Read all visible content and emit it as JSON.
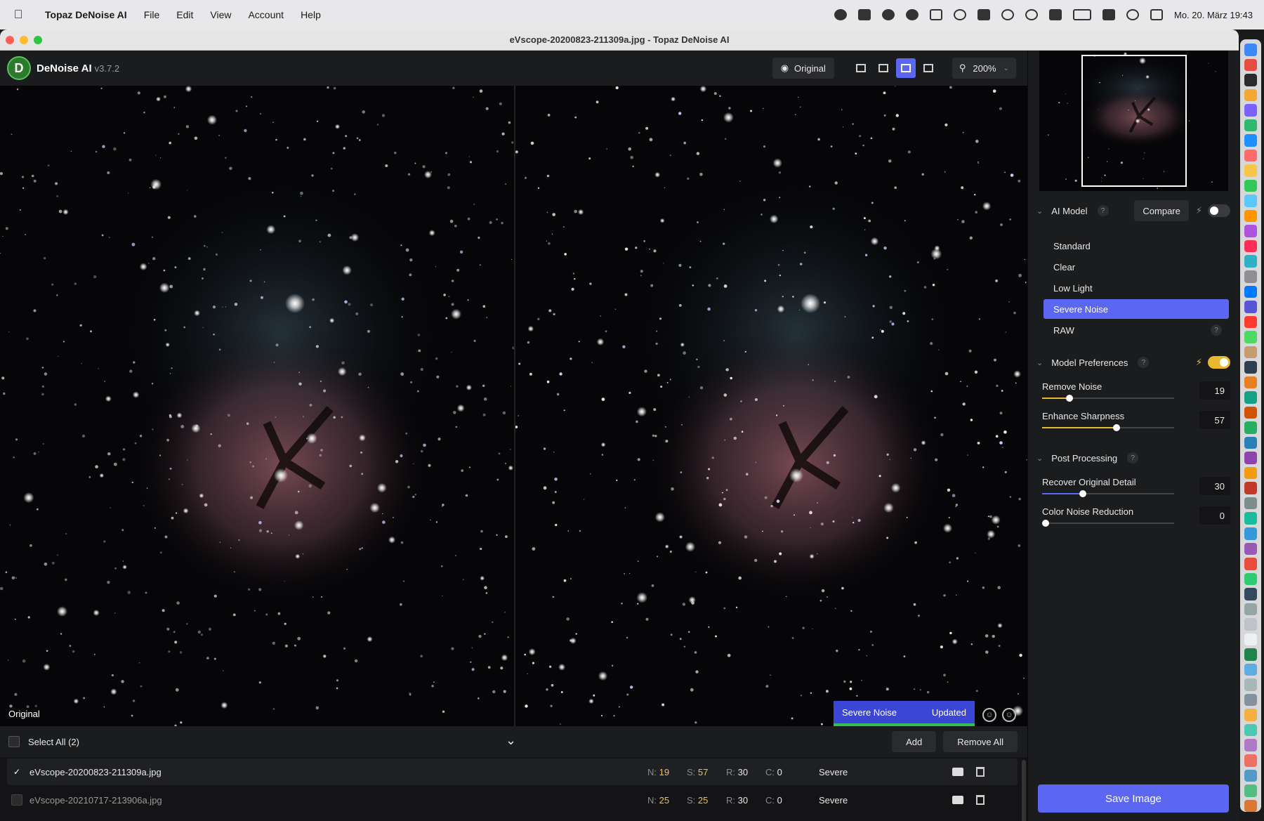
{
  "menubar": {
    "app_name": "Topaz DeNoise AI",
    "items": [
      "File",
      "Edit",
      "View",
      "Account",
      "Help"
    ],
    "datetime": "Mo. 20. März  19:43"
  },
  "window": {
    "title": "eVscope-20200823-211309a.jpg - Topaz DeNoise AI"
  },
  "toolbar": {
    "app_name": "DeNoise AI",
    "version": "v3.7.2",
    "original_label": "Original",
    "zoom": "200%"
  },
  "viewer": {
    "left_label": "Original",
    "model_badge": "Severe Noise",
    "status_badge": "Updated"
  },
  "file_bar": {
    "select_all": "Select All (2)",
    "add_label": "Add",
    "remove_all_label": "Remove All"
  },
  "files": [
    {
      "name": "eVscope-20200823-211309a.jpg",
      "n": "19",
      "s": "57",
      "r": "30",
      "c": "0",
      "preset": "Severe",
      "selected": true
    },
    {
      "name": "eVscope-20210717-213906a.jpg",
      "n": "25",
      "s": "25",
      "r": "30",
      "c": "0",
      "preset": "Severe",
      "selected": false
    }
  ],
  "stat_keys": {
    "n": "N:",
    "s": "S:",
    "r": "R:",
    "c": "C:"
  },
  "sidebar": {
    "ai_model": {
      "title": "AI Model",
      "compare_label": "Compare",
      "models": [
        "Standard",
        "Clear",
        "Low Light",
        "Severe Noise",
        "RAW"
      ],
      "active": "Severe Noise"
    },
    "model_prefs": {
      "title": "Model Preferences",
      "remove_noise": {
        "label": "Remove Noise",
        "value": "19",
        "fraction": 0.19
      },
      "enhance_sharpness": {
        "label": "Enhance Sharpness",
        "value": "57",
        "fraction": 0.57
      }
    },
    "post_processing": {
      "title": "Post Processing",
      "recover_detail": {
        "label": "Recover Original Detail",
        "value": "30",
        "fraction": 0.3
      },
      "color_noise": {
        "label": "Color Noise Reduction",
        "value": "0",
        "fraction": 0.0
      }
    },
    "save_label": "Save Image"
  },
  "help_glyph": "?",
  "colors": {
    "accent": "#5b67f0",
    "slider_fill": "#e8b830",
    "status_green": "#2fbf5a"
  }
}
